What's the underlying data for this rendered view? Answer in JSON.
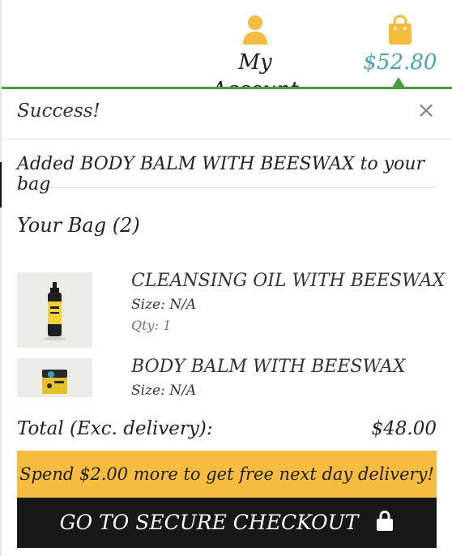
{
  "header": {
    "account_label": "My Account",
    "bag_total": "$52.80",
    "account_icon": "user-icon",
    "bag_icon": "shopping-bag-icon"
  },
  "notice": {
    "title": "Success!",
    "close_glyph": "×",
    "message": "Added BODY BALM WITH BEESWAX to your bag"
  },
  "bag": {
    "heading": "Your Bag (2)",
    "items": [
      {
        "name": "CLEANSING OIL WITH BEESWAX",
        "size": "Size: N/A",
        "qty": "Qty: 1"
      },
      {
        "name": "BODY BALM WITH BEESWAX",
        "size": "Size: N/A"
      }
    ],
    "total_label": "Total (Exc. delivery):",
    "total_value": "$48.00"
  },
  "promo": {
    "text": "Spend $2.00 more to get free next day delivery!"
  },
  "checkout": {
    "label": "GO TO SECURE CHECKOUT",
    "icon": "lock-icon"
  },
  "colors": {
    "accent_green": "#4b9c3f",
    "price_blue": "#4aa3b5",
    "icon_yellow": "#f6bc3f",
    "promo_yellow": "#f6bc3f",
    "checkout_black": "#181818"
  }
}
